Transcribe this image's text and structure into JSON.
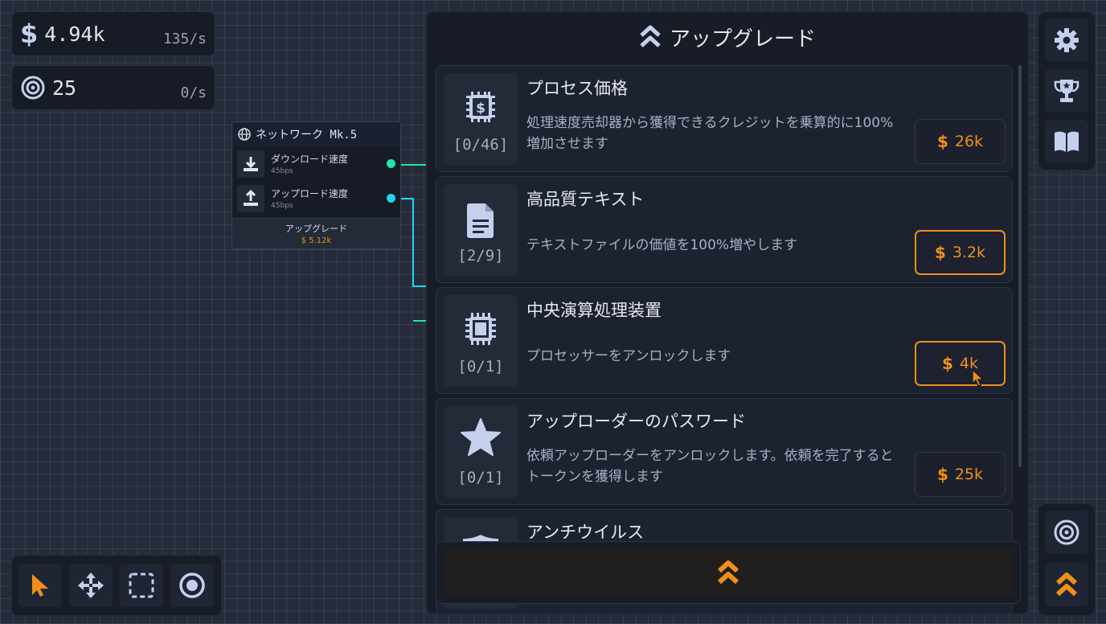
{
  "hud": {
    "money": {
      "icon": "dollar-icon",
      "value": "4.94k",
      "rate": "135/s"
    },
    "tokens": {
      "icon": "token-icon",
      "value": "25",
      "rate": "0/s"
    }
  },
  "node": {
    "icon": "globe-icon",
    "title": "ネットワーク Mk.5",
    "ports": [
      {
        "icon": "download-icon",
        "label": "ダウンロード速度",
        "sub": "45bps",
        "color": "#1de9a6"
      },
      {
        "icon": "upload-icon",
        "label": "アップロード速度",
        "sub": "45bps",
        "color": "#22d3ee"
      }
    ],
    "upgrade_label": "アップグレード",
    "upgrade_price": "$ 5.12k"
  },
  "upgrades": {
    "title": "アップグレード",
    "items": [
      {
        "icon": "chip-dollar-icon",
        "title": "プロセス価格",
        "level": "[0/46]",
        "desc": "処理速度売却器から獲得できるクレジットを乗算的に100%増加させます",
        "price": "26k",
        "affordable": false
      },
      {
        "icon": "document-icon",
        "title": "高品質テキスト",
        "level": "[2/9]",
        "desc": "テキストファイルの価値を100%増やします",
        "price": "3.2k",
        "affordable": true
      },
      {
        "icon": "cpu-icon",
        "title": "中央演算処理装置",
        "level": "[0/1]",
        "desc": "プロセッサーをアンロックします",
        "price": "4k",
        "affordable": true
      },
      {
        "icon": "star-icon",
        "title": "アップローダーのパスワード",
        "level": "[0/1]",
        "desc": "依頼アップローダーをアンロックします。依頼を完了するとトークンを獲得します",
        "price": "25k",
        "affordable": false
      },
      {
        "icon": "shield-icon",
        "title": "アンチウイルス",
        "level": "",
        "desc": "",
        "price": "",
        "affordable": false
      }
    ],
    "currency_symbol": "$"
  },
  "side_top": [
    "gear-icon",
    "trophy-icon",
    "book-icon"
  ],
  "side_bottom": [
    "token-icon",
    "upgrade-chevrons-icon"
  ],
  "toolbar": [
    "pointer-icon",
    "move-icon",
    "select-box-icon",
    "target-icon"
  ],
  "colors": {
    "accent": "#f0901a",
    "wire_green": "#1de9a6",
    "wire_cyan": "#22d3ee",
    "icon": "#c5d0ee"
  }
}
